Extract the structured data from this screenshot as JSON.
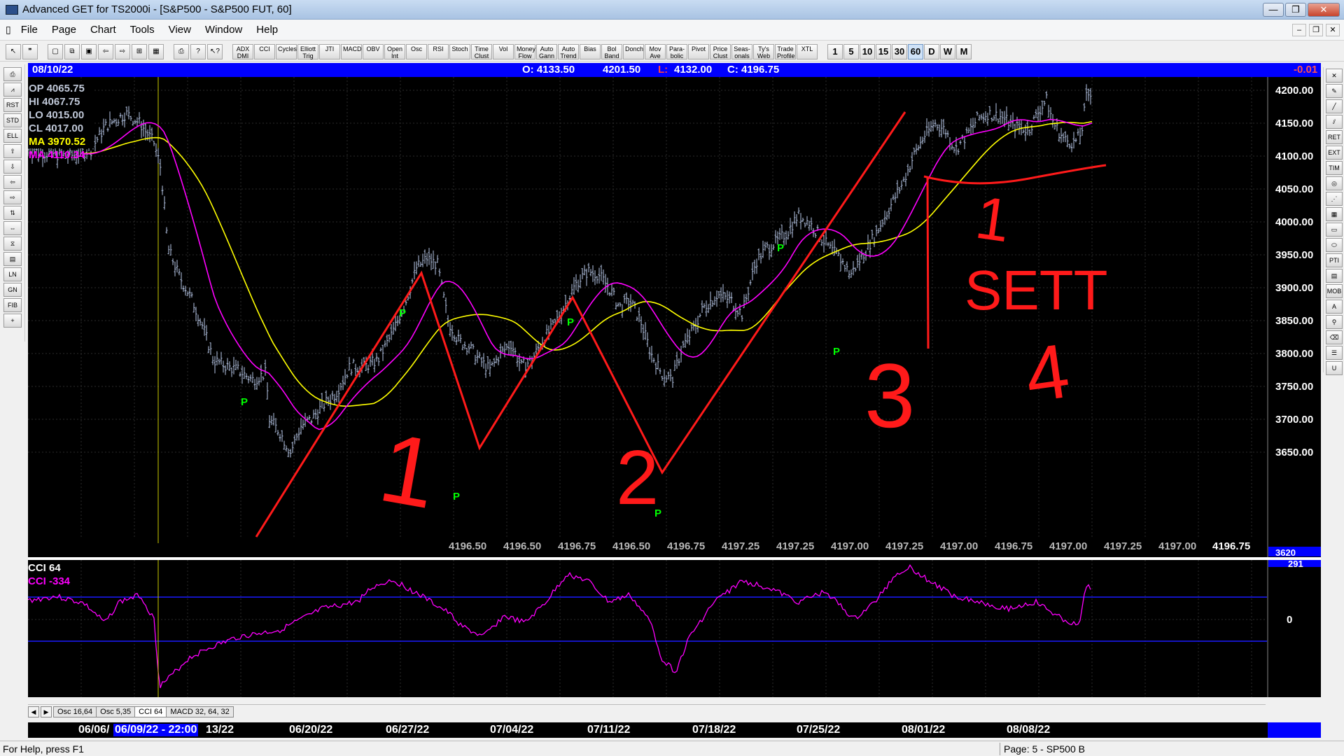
{
  "window": {
    "title": "Advanced GET for TS2000i - [S&P500 - S&P500 FUT, 60]",
    "min": "—",
    "max": "❐",
    "close": "✕"
  },
  "menu": [
    "File",
    "Page",
    "Chart",
    "Tools",
    "View",
    "Window",
    "Help"
  ],
  "toolbar": {
    "indicators": [
      "ADX DMI",
      "CCI",
      "Cycles",
      "Elliott Trig",
      "JTI",
      "MACD",
      "OBV",
      "Open Int",
      "Osc",
      "RSI",
      "Stoch",
      "Time Clust",
      "Vol",
      "Money Flow",
      "Auto Gann",
      "Auto Trend",
      "Bias",
      "Bol Band",
      "Donch",
      "Mov Ave",
      "Para-bolic",
      "Pivot",
      "Price Clust",
      "Seas-onals",
      "Ty's Web",
      "Trade Profile",
      "XTL"
    ],
    "periods": [
      "1",
      "5",
      "10",
      "15",
      "30",
      "60",
      "D",
      "W",
      "M"
    ],
    "active_period": "60"
  },
  "info": {
    "date": "08/10/22",
    "open": "O: 4133.50",
    "high": "4201.50",
    "low_label": "L:",
    "low": "4132.00",
    "close": "C: 4196.75",
    "change": "-0.01"
  },
  "legend": {
    "op": "OP  4065.75",
    "hi": "HI   4067.75",
    "lo": "LO  4015.00",
    "cl": "CL  4017.00",
    "ma1": "MA  3970.52",
    "ma2": "MA  4110.34"
  },
  "colors": {
    "bg": "#000000",
    "bars": "#b8c8e8",
    "ma_yellow": "#ffff00",
    "ma_magenta": "#ff00ff",
    "annotation": "#ff1a1a",
    "pivot": "#00ff00",
    "band": "#0000ff"
  },
  "price_axis": [
    {
      "label": "4200.00",
      "v": 4200
    },
    {
      "label": "4150.00",
      "v": 4150
    },
    {
      "label": "4100.00",
      "v": 4100
    },
    {
      "label": "4050.00",
      "v": 4050
    },
    {
      "label": "4000.00",
      "v": 4000
    },
    {
      "label": "3950.00",
      "v": 3950
    },
    {
      "label": "3900.00",
      "v": 3900
    },
    {
      "label": "3850.00",
      "v": 3850
    },
    {
      "label": "3800.00",
      "v": 3800
    },
    {
      "label": "3750.00",
      "v": 3750
    },
    {
      "label": "3700.00",
      "v": 3700
    },
    {
      "label": "3650.00",
      "v": 3650
    }
  ],
  "axis_partial": "3620",
  "bottom_prices": [
    "4196.50",
    "4196.50",
    "4196.75",
    "4196.50",
    "4196.75",
    "4197.25",
    "4197.25",
    "4197.00",
    "4197.25",
    "4197.00",
    "4196.75",
    "4197.00",
    "4197.25",
    "4197.00"
  ],
  "last_price": "4196.75",
  "pivot_label": "P",
  "annotations": {
    "n1": "1",
    "n2": "2",
    "n3": "3",
    "n4": "4",
    "sett": "SETT"
  },
  "cci": {
    "title": "CCI 64",
    "value": "CCI  -334",
    "axis_top": "291",
    "axis_zero": "0"
  },
  "osc_tabs": [
    "Osc 16,64",
    "Osc 5,35",
    "CCI 64",
    "MACD 32, 64, 32"
  ],
  "active_osc_tab": "CCI 64",
  "dates": [
    "06/06/",
    "13/22",
    "06/20/22",
    "06/27/22",
    "07/04/22",
    "07/11/22",
    "07/18/22",
    "07/25/22",
    "08/01/22",
    "08/08/22"
  ],
  "date_cursor": "06/09/22 - 22:00",
  "status": {
    "left": "For Help, press F1",
    "right": "Page: 5 - SP500 B"
  }
}
